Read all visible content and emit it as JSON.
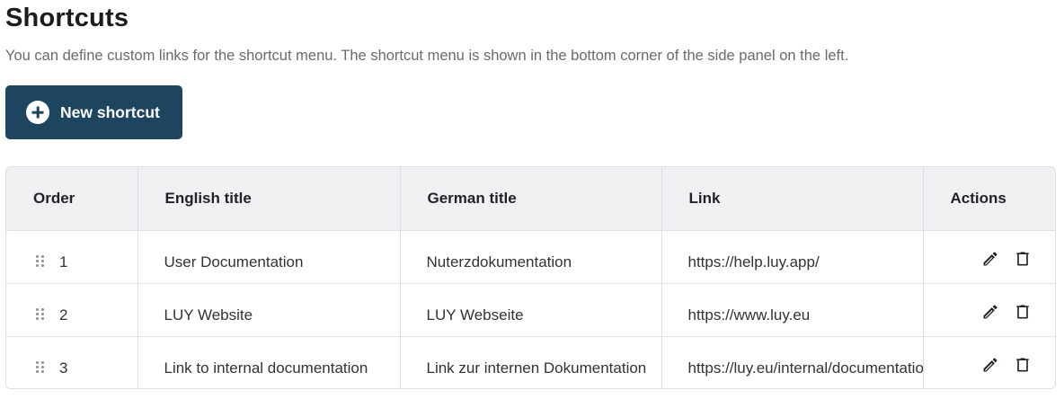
{
  "header": {
    "title": "Shortcuts",
    "description": "You can define custom links for the shortcut menu. The shortcut menu is shown in the bottom corner of the side panel on the left."
  },
  "new_button": {
    "label": "New shortcut",
    "icon": "plus-circle-icon",
    "color": "#1e4560"
  },
  "table": {
    "columns": {
      "order": "Order",
      "english": "English title",
      "german": "German title",
      "link": "Link",
      "actions": "Actions"
    },
    "rows": [
      {
        "order": "1",
        "english": "User Documentation",
        "german": "Nuterzdokumentation",
        "link": "https://help.luy.app/"
      },
      {
        "order": "2",
        "english": "LUY Website",
        "german": "LUY Webseite",
        "link": "https://www.luy.eu"
      },
      {
        "order": "3",
        "english": "Link to internal documentation",
        "german": "Link zur internen Dokumentation",
        "link": "https://luy.eu/internal/documentation"
      }
    ],
    "row_icons": [
      "drag-handle-icon",
      "pencil-icon",
      "trash-icon"
    ]
  }
}
